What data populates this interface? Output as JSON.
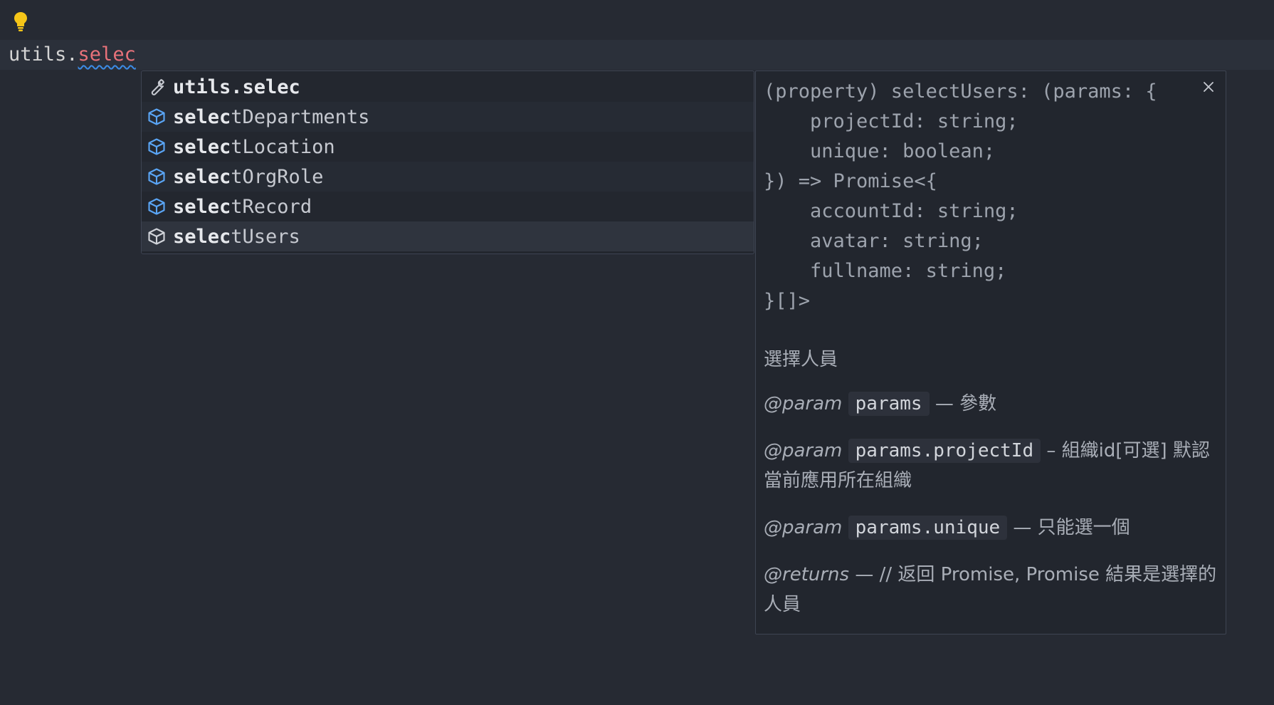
{
  "editor": {
    "typed_prefix": "utils.",
    "typed_error": "selec"
  },
  "suggest": {
    "items": [
      {
        "icon": "wrench-icon",
        "match": "utils.selec",
        "rest": ""
      },
      {
        "icon": "cube-icon",
        "match": "selec",
        "rest": "tDepartments"
      },
      {
        "icon": "cube-icon",
        "match": "selec",
        "rest": "tLocation"
      },
      {
        "icon": "cube-icon",
        "match": "selec",
        "rest": "tOrgRole"
      },
      {
        "icon": "cube-icon",
        "match": "selec",
        "rest": "tRecord"
      },
      {
        "icon": "cube-outline-icon",
        "match": "selec",
        "rest": "tUsers"
      }
    ]
  },
  "details": {
    "signature": [
      "(property) selectUsers: (params: {",
      "    projectId: string;",
      "    unique: boolean;",
      "}) => Promise<{",
      "    accountId: string;",
      "    avatar: string;",
      "    fullname: string;",
      "}[]>"
    ],
    "description": "選擇人員",
    "params": [
      {
        "tag": "@param",
        "name": "params",
        "text": " — 參數"
      },
      {
        "tag": "@param",
        "name": "params.projectId",
        "text": " – 組織id[可選] 默認當前應用所在組織"
      },
      {
        "tag": "@param",
        "name": "params.unique",
        "text": " — 只能選一個"
      }
    ],
    "returns": {
      "tag": "@returns",
      "text": " — // 返回 Promise, Promise 結果是選擇的人員"
    }
  },
  "colors": {
    "background": "#262a33",
    "error_text": "#e8727a",
    "squiggle": "#3c8ce7",
    "cube_icon": "#5aa5f5",
    "bulb": "#f5c518"
  }
}
